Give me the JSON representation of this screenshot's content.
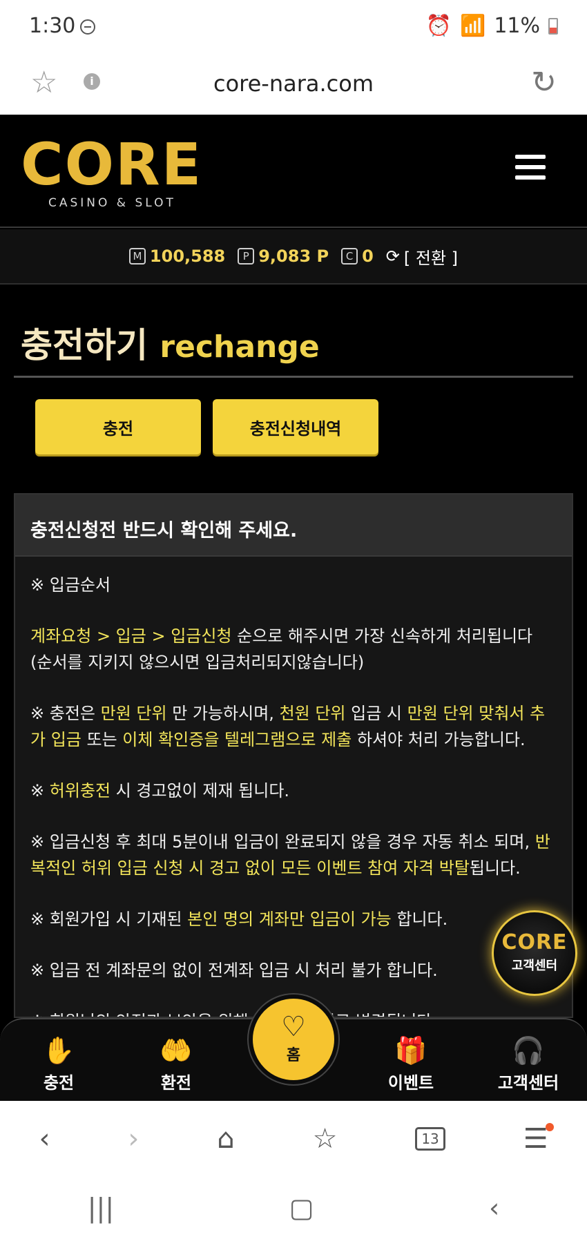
{
  "status_bar": {
    "time": "1:30",
    "battery": "11%"
  },
  "browser": {
    "url": "core-nara.com"
  },
  "site": {
    "logo_word": "CORE",
    "logo_sub": "CASINO & SLOT"
  },
  "balance": {
    "money_icon": "M",
    "money": "100,588",
    "point_icon": "P",
    "point": "9,083 P",
    "coin_icon": "C",
    "coin": "0",
    "switch_label": "[ 전환 ]"
  },
  "page": {
    "title_ko": "충전하기",
    "title_en": "rechange"
  },
  "buttons": {
    "charge": "충전",
    "history": "충전신청내역"
  },
  "notice": {
    "heading": "충전신청전 반드시 확인해 주세요.",
    "p1": "※ 입금순서",
    "p2_hl": "계좌요청 > 입금 > 입금신청",
    "p2_rest": " 순으로 해주시면 가장 신속하게 처리됩니다 (순서를 지키지 않으시면 입금처리되지않습니다)",
    "p3_a": "※ 충전은 ",
    "p3_b": "만원 단위",
    "p3_c": " 만 가능하시며, ",
    "p3_d": "천원 단위",
    "p3_e": " 입금 시 ",
    "p3_f": "만원 단위 맞춰서 추가 입금",
    "p3_g": " 또는 ",
    "p3_h": "이체 확인증을 텔레그램으로 제출",
    "p3_i": " 하셔야 처리 가능합니다.",
    "p4_a": "※ ",
    "p4_b": "허위충전",
    "p4_c": " 시 경고없이 제재 됩니다.",
    "p5_a": "※ 입금신청 후 최대 5분이내 입금이 완료되지 않을 경우 자동 취소 되며, ",
    "p5_b": "반복적인 허위 입금 신청 시 경고 없이 모든 이벤트 참여 자격 박탈",
    "p5_c": "됩니다.",
    "p6_a": "※ 회원가입 시 기재된 ",
    "p6_b": "본인 명의 계좌만 입금이 가능",
    "p6_c": " 합니다.",
    "p7": "※ 입금 전 계좌문의 없이 전계좌 입금 시 처리 불가 합니다.",
    "p8": "※ 회원님의 안전과 보안을 위해 계좌는 수시로 변경됩니다."
  },
  "cs_badge": {
    "word": "CORE",
    "label": "고객센터"
  },
  "bottom_nav": {
    "charge": "충전",
    "exchange": "환전",
    "home": "홈",
    "event": "이벤트",
    "cs": "고객센터"
  },
  "browser_toolbar": {
    "tab_count": "13"
  },
  "colors": {
    "accent_yellow": "#f4d43c",
    "highlight_text": "#f3e55a",
    "background": "#000000"
  }
}
